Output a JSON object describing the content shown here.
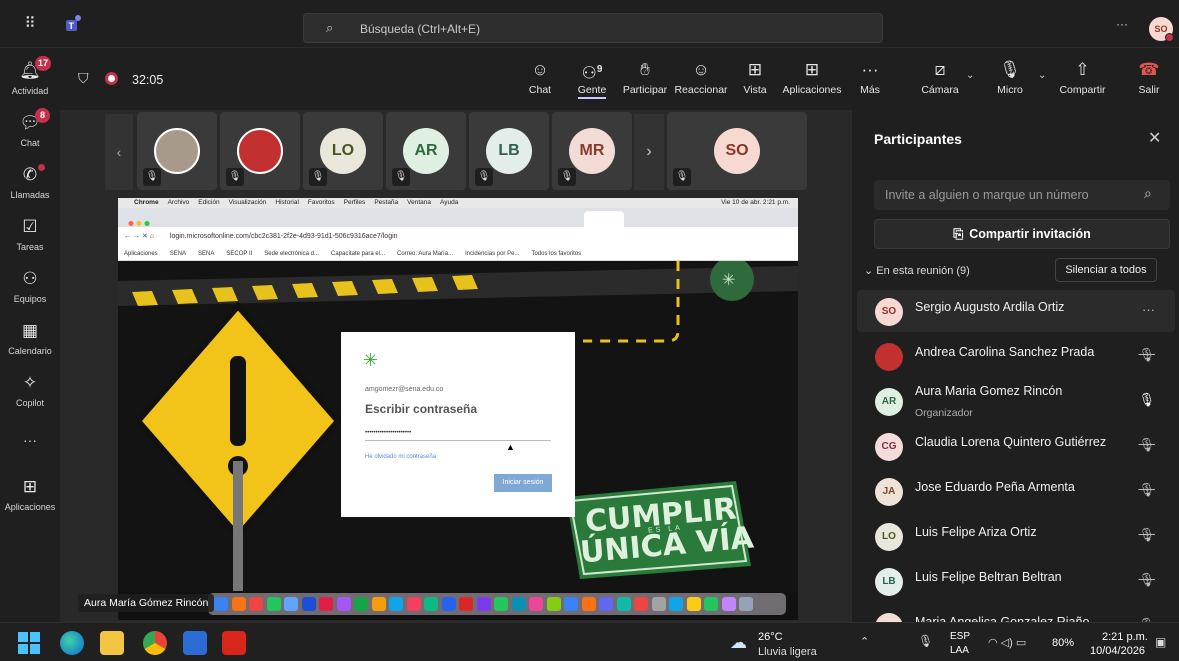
{
  "topbar": {
    "search_placeholder": "Búsqueda (Ctrl+Alt+E)",
    "more": "···",
    "avatar_initials": "SO"
  },
  "rail": {
    "items": [
      {
        "label": "Actividad",
        "badge": "17",
        "icon": "bell-icon"
      },
      {
        "label": "Chat",
        "badge": "8",
        "icon": "chat-icon"
      },
      {
        "label": "Llamadas",
        "badge": "",
        "icon": "phone-icon"
      },
      {
        "label": "Tareas",
        "badge": "",
        "icon": "tasks-icon"
      },
      {
        "label": "Equipos",
        "badge": "",
        "icon": "teams-icon"
      },
      {
        "label": "Calendario",
        "badge": "",
        "icon": "calendar-icon"
      },
      {
        "label": "Copilot",
        "badge": "",
        "icon": "copilot-icon"
      },
      {
        "label": "···",
        "badge": "",
        "icon": "more-icon"
      },
      {
        "label": "Aplicaciones",
        "badge": "",
        "icon": "apps-icon"
      }
    ]
  },
  "meeting": {
    "timer": "32:05",
    "people_count": "9",
    "buttons": [
      "Chat",
      "Gente",
      "Participar",
      "Reaccionar",
      "Vista",
      "Aplicaciones",
      "Más",
      "Cámara",
      "Micro",
      "Compartir",
      "Salir"
    ]
  },
  "tiles": [
    {
      "initials": "",
      "kind": "photo",
      "bg": "#a89a8a"
    },
    {
      "initials": "",
      "kind": "photo",
      "bg": "#c23030"
    },
    {
      "initials": "LO",
      "bg": "#e9e7dc",
      "fg": "#4b5320"
    },
    {
      "initials": "AR",
      "bg": "#dff0e3",
      "fg": "#2d6a3e"
    },
    {
      "initials": "LB",
      "bg": "#e3eeea",
      "fg": "#2f5f4f"
    },
    {
      "initials": "MR",
      "bg": "#f3dcd6",
      "fg": "#8a3c2c"
    },
    {
      "initials": "SO",
      "bg": "#f7d9d2",
      "fg": "#8a3626"
    }
  ],
  "share": {
    "mac_menu": [
      "Chrome",
      "Archivo",
      "Edición",
      "Visualización",
      "Historial",
      "Favoritos",
      "Perfiles",
      "Pestaña",
      "Ventana",
      "Ayuda"
    ],
    "mac_clock": "Vie 10 de abr. 2:21 p.m.",
    "url": "login.microsoftonline.com/cbc2c381-2f2e-4d93-91d1-506c9316ace7/login",
    "bookmarks": [
      "Aplicaciones",
      "SENA",
      "SENA",
      "SECOP II",
      "Sede electrónica d...",
      "Capacítate para el...",
      "Correo: Aura María...",
      "Incidencias por Pe...",
      "Todos los favoritos"
    ],
    "login": {
      "email": "amgomezr@sena.edu.co",
      "title": "Escribir contraseña",
      "password": "••••••••••••••••••••••",
      "forgot": "He olvidado mi contraseña",
      "button": "Iniciar sesión"
    },
    "sign_top": "CUMPLIR",
    "sign_mid": "ES LA",
    "sign_bottom": "ÚNICA VÍA",
    "presenter": "Aura María Gómez Rincón"
  },
  "panel": {
    "title": "Participantes",
    "invite_placeholder": "Invite a alguien o marque un número",
    "share_invite": "Compartir invitación",
    "in_meeting": "En esta reunión (9)",
    "mute_all": "Silenciar a todos",
    "people": [
      {
        "initials": "SO",
        "name": "Sergio Augusto Ardila Ortiz",
        "role": "",
        "bg": "#f7d9d2",
        "fg": "#8a3626",
        "state": "more"
      },
      {
        "initials": "",
        "name": "Andrea Carolina Sanchez Prada",
        "role": "",
        "bg": "#c23030",
        "fg": "#fff",
        "state": "muted"
      },
      {
        "initials": "AR",
        "name": "Aura Maria Gomez Rincón",
        "role": "Organizador",
        "bg": "#dff0e3",
        "fg": "#2d6a3e",
        "state": "mic"
      },
      {
        "initials": "CG",
        "name": "Claudia Lorena Quintero Gutiérrez",
        "role": "",
        "bg": "#f3dcdc",
        "fg": "#8a2c3c",
        "state": "muted"
      },
      {
        "initials": "JA",
        "name": "Jose Eduardo Peña Armenta",
        "role": "",
        "bg": "#efe3d8",
        "fg": "#7a4a2a",
        "state": "muted"
      },
      {
        "initials": "LO",
        "name": "Luis Felipe Ariza Ortiz",
        "role": "",
        "bg": "#e9e7dc",
        "fg": "#4b5320",
        "state": "muted"
      },
      {
        "initials": "LB",
        "name": "Luis Felipe Beltran Beltran",
        "role": "",
        "bg": "#e3eeea",
        "fg": "#2f5f4f",
        "state": "muted"
      },
      {
        "initials": "MR",
        "name": "Maria Angelica Gonzalez Riaño",
        "role": "",
        "bg": "#f3dcd6",
        "fg": "#8a3c2c",
        "state": "muted"
      }
    ]
  },
  "taskbar": {
    "temp": "26°C",
    "weather": "Lluvia ligera",
    "lang1": "ESP",
    "lang2": "LAA",
    "battery": "80%",
    "time": "2:21 p.m.",
    "date": "10/04/2026"
  }
}
